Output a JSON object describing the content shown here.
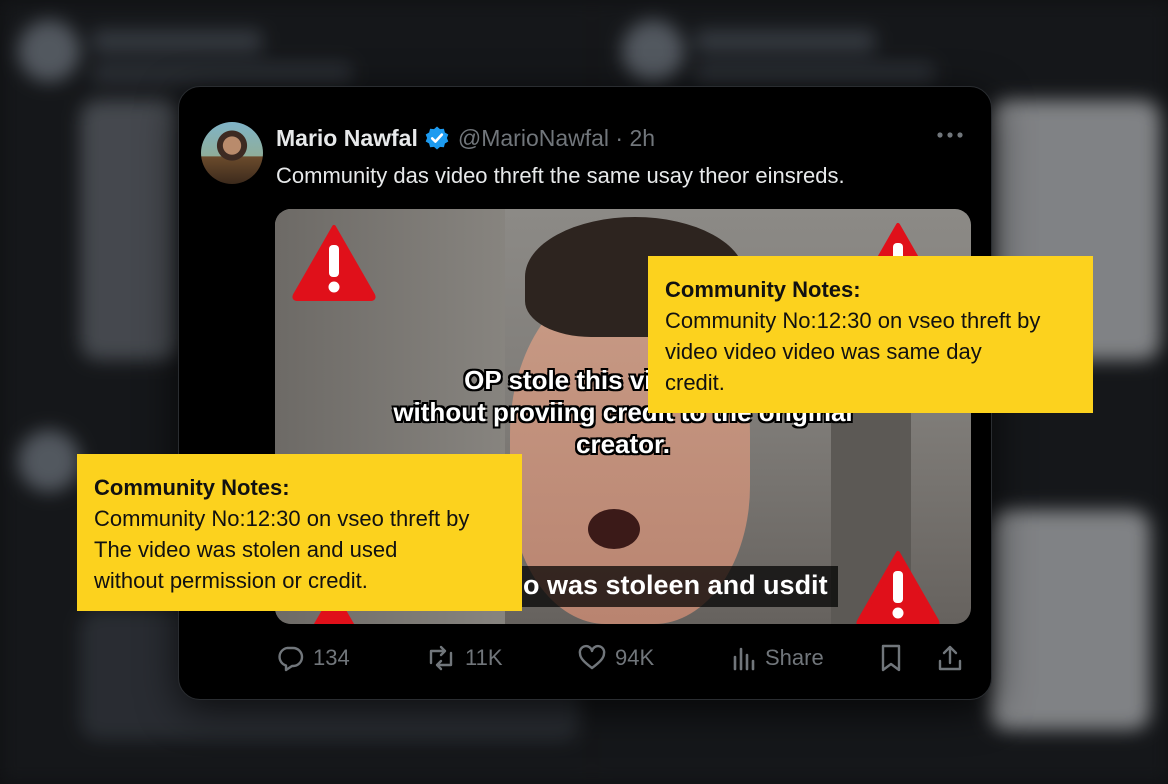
{
  "tweet": {
    "author_name": "Mario Nawfal",
    "handle_time": "@MarioNawfal · 2h",
    "text": "Community das video thr͏eft the same usay theor einsreds.",
    "video": {
      "caption_lines": [
        "OP stole this vide",
        "without proviing credit to the original",
        "creator."
      ],
      "subtitle": "o was stoleen and usdit"
    },
    "actions": {
      "replies": "134",
      "reposts": "11K",
      "likes": "94K",
      "share": "Share"
    }
  },
  "notes": [
    {
      "title": "Community Notes:",
      "lines": [
        "Community No:12:30 on vseo threft by",
        "video video video was same day",
        "credit."
      ]
    },
    {
      "title": "Community Notes:",
      "lines": [
        "Community No:12:30 on vseo threft by",
        "The video was stolen and used",
        "without permission or credit."
      ]
    }
  ],
  "colors": {
    "note_yellow": "#fcd21e",
    "verified_blue": "#1d9bf0",
    "warning_red": "#e0101a",
    "muted_text": "#71767b"
  },
  "icons": [
    "verified-badge-icon",
    "more-icon",
    "warning-icon",
    "reply-icon",
    "repost-icon",
    "like-icon",
    "views-icon",
    "bookmark-icon",
    "share-icon"
  ]
}
